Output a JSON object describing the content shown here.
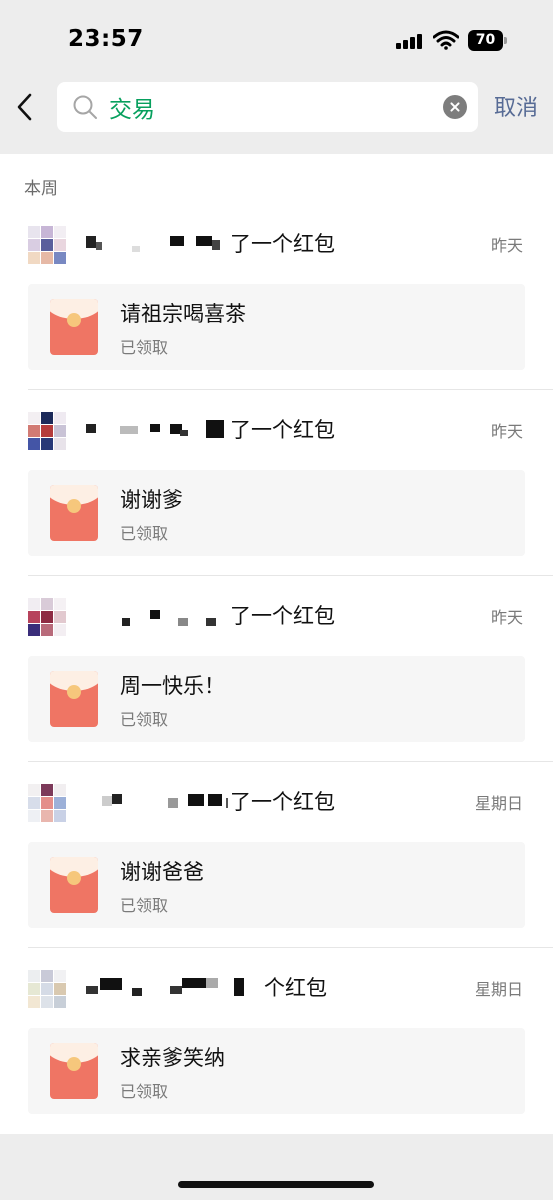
{
  "status_bar": {
    "time": "23:57",
    "battery": "70",
    "icons": [
      "signal-icon",
      "wifi-icon",
      "battery-icon"
    ]
  },
  "search": {
    "query": "交易",
    "cancel_label": "取消",
    "icons": [
      "back-icon",
      "search-icon",
      "clear-icon"
    ]
  },
  "section": {
    "label": "本周"
  },
  "results": [
    {
      "title": "了一个红包",
      "date": "昨天",
      "message": "请祖宗喝喜茶",
      "status": "已领取"
    },
    {
      "title": "了一个红包",
      "date": "昨天",
      "message": "谢谢爹",
      "status": "已领取"
    },
    {
      "title": "了一个红包",
      "date": "昨天",
      "message": "周一快乐！",
      "status": "已领取"
    },
    {
      "title": "了一个红包",
      "date": "星期日",
      "message": "谢谢爸爸",
      "status": "已领取"
    },
    {
      "title": "个红包",
      "date": "星期日",
      "message": "求亲爹笑纳",
      "status": "已领取"
    }
  ],
  "colors": {
    "accent": "#07a05e",
    "link": "#576b95",
    "red_packet": "#ef7564",
    "background": "#ededed"
  }
}
